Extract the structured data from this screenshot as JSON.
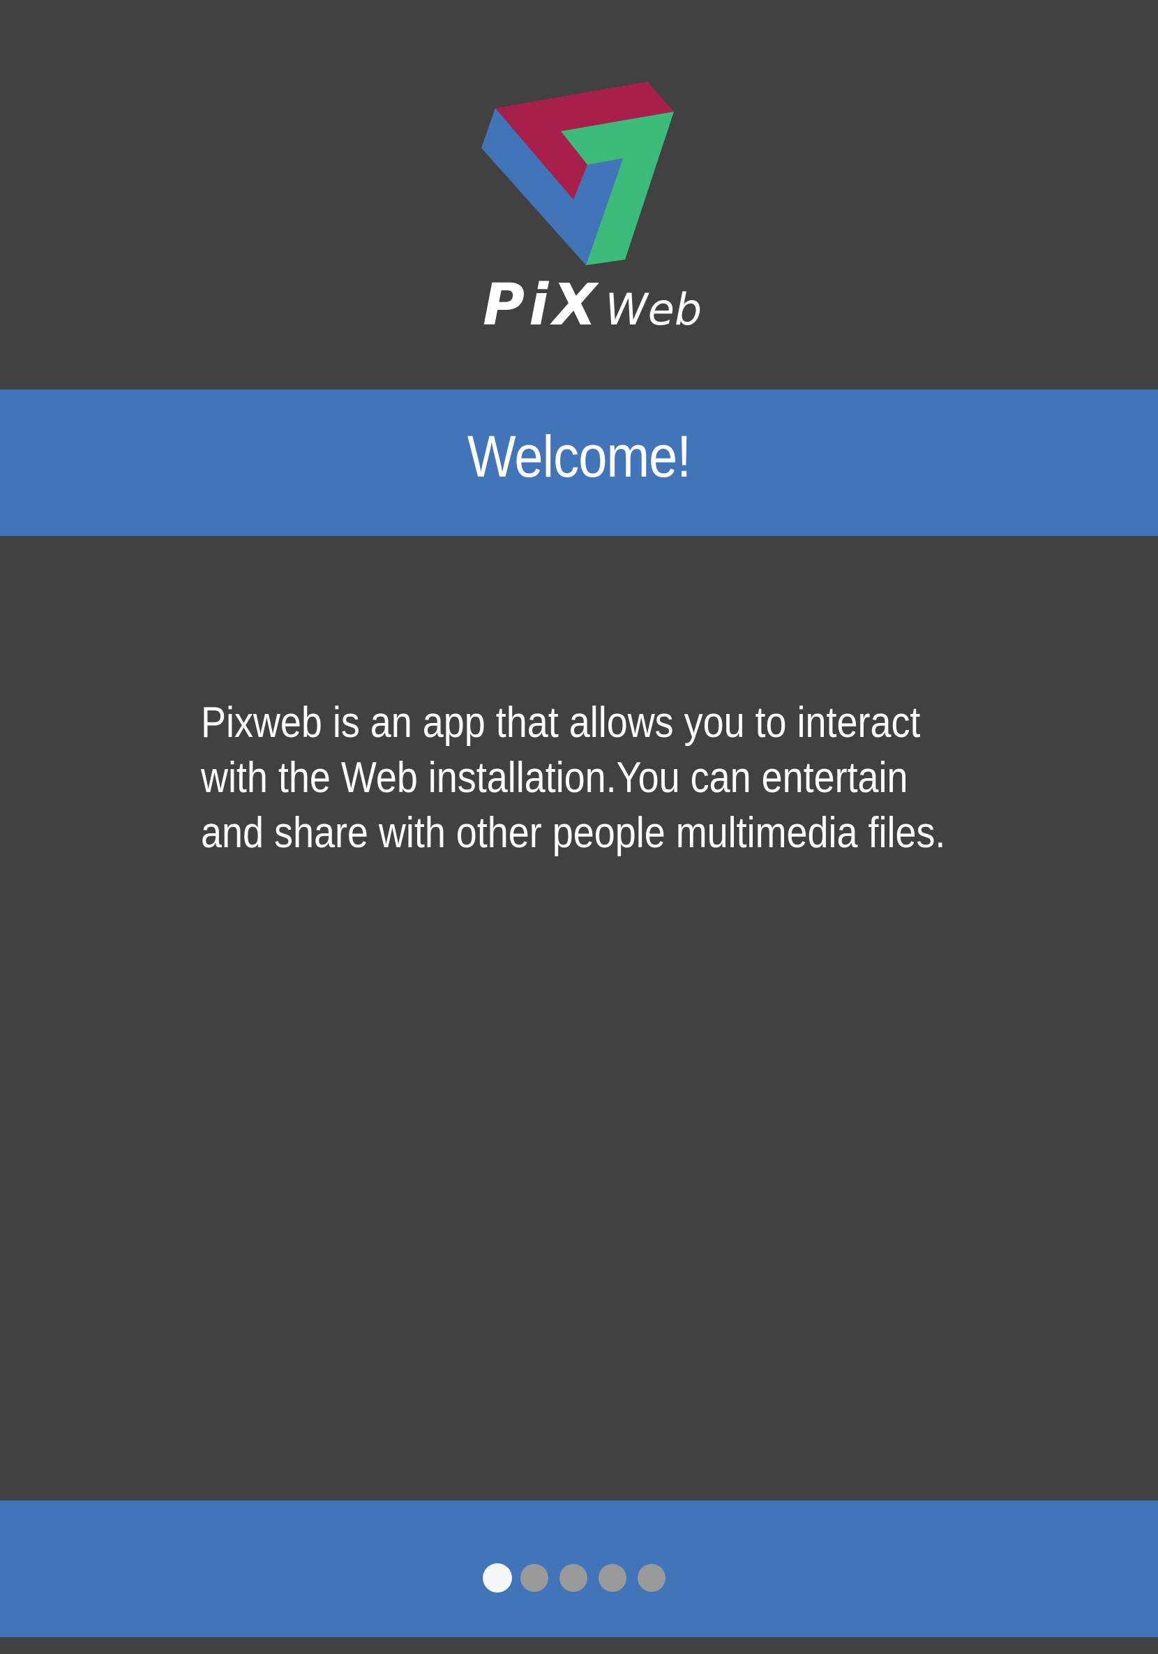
{
  "app": {
    "name_primary": "PiX",
    "name_secondary": "Web",
    "logo_icon": "pixweb-triangle-logo-icon"
  },
  "welcome": {
    "title": "Welcome!"
  },
  "description": {
    "lines": [
      "Pixweb is an app that allows you to interact",
      "with the Web installation.You can entertain",
      "and share with other people multimedia files."
    ]
  },
  "pager": {
    "total_pages": 5,
    "current_page": 1
  },
  "colors": {
    "background": "#414141",
    "accent_blue": "#4274b9",
    "logo_crimson": "#a81f4b",
    "logo_green": "#3dbb7b",
    "logo_blue": "#4274b9",
    "dot_active": "#f4f6f8",
    "dot_inactive": "#9a9a9a"
  }
}
